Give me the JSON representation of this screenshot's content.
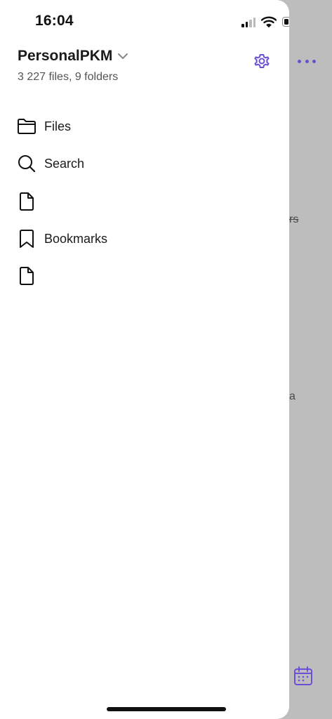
{
  "status_bar": {
    "time": "16:04"
  },
  "vault": {
    "name": "PersonalPKM",
    "meta": "3 227 files, 9 folders"
  },
  "menu": {
    "items": [
      {
        "label": "Files",
        "icon": "folder-icon"
      },
      {
        "label": "Search",
        "icon": "search-icon"
      },
      {
        "label": "",
        "icon": "file-icon"
      },
      {
        "label": "Bookmarks",
        "icon": "bookmark-icon"
      },
      {
        "label": "",
        "icon": "file-icon"
      }
    ]
  },
  "background": {
    "fragment_1": "rs",
    "fragment_2": "a"
  },
  "colors": {
    "accent": "#6b4fd6",
    "drawer_bg": "#ffffff",
    "overlay_bg": "#bdbdbd"
  }
}
